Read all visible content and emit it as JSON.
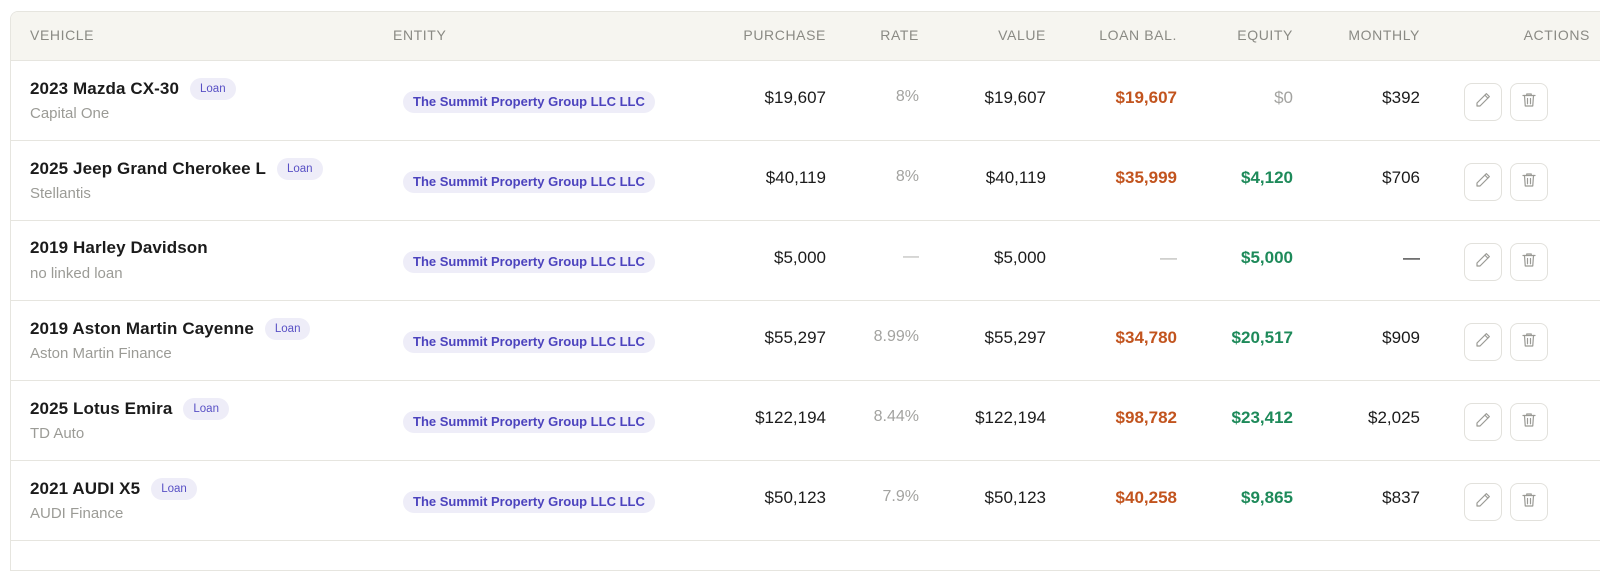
{
  "table": {
    "headers": {
      "vehicle": "VEHICLE",
      "entity": "ENTITY",
      "purchase": "PURCHASE",
      "rate": "RATE",
      "value": "VALUE",
      "loan_bal": "LOAN BAL.",
      "equity": "EQUITY",
      "monthly": "MONTHLY",
      "actions": "ACTIONS"
    },
    "rows": [
      {
        "name": "2023 Mazda CX-30",
        "badge": "Loan",
        "sub": "Capital One",
        "entity": "The Summit Property Group LLC LLC",
        "purchase": "$19,607",
        "rate": "8%",
        "value": "$19,607",
        "loan_bal": "$19,607",
        "equity": "$0",
        "monthly": "$392"
      },
      {
        "name": "2025 Jeep Grand Cherokee L",
        "badge": "Loan",
        "sub": "Stellantis",
        "entity": "The Summit Property Group LLC LLC",
        "purchase": "$40,119",
        "rate": "8%",
        "value": "$40,119",
        "loan_bal": "$35,999",
        "equity": "$4,120",
        "monthly": "$706"
      },
      {
        "name": "2019 Harley Davidson",
        "badge": "",
        "sub": "no linked loan",
        "entity": "The Summit Property Group LLC LLC",
        "purchase": "$5,000",
        "rate": "—",
        "value": "$5,000",
        "loan_bal": "—",
        "equity": "$5,000",
        "monthly": "—"
      },
      {
        "name": "2019 Aston Martin Cayenne",
        "badge": "Loan",
        "sub": "Aston Martin Finance",
        "entity": "The Summit Property Group LLC LLC",
        "purchase": "$55,297",
        "rate": "8.99%",
        "value": "$55,297",
        "loan_bal": "$34,780",
        "equity": "$20,517",
        "monthly": "$909"
      },
      {
        "name": "2025 Lotus Emira",
        "badge": "Loan",
        "sub": "TD Auto",
        "entity": "The Summit Property Group LLC LLC",
        "purchase": "$122,194",
        "rate": "8.44%",
        "value": "$122,194",
        "loan_bal": "$98,782",
        "equity": "$23,412",
        "monthly": "$2,025"
      },
      {
        "name": "2021 AUDI X5",
        "badge": "Loan",
        "sub": "AUDI Finance",
        "entity": "The Summit Property Group LLC LLC",
        "purchase": "$50,123",
        "rate": "7.9%",
        "value": "$50,123",
        "loan_bal": "$40,258",
        "equity": "$9,865",
        "monthly": "$837"
      }
    ]
  },
  "colors": {
    "loan_balance": "#c2541e",
    "equity": "#1e8a5a",
    "badge_bg": "#eeedf8",
    "badge_text": "#4c43be",
    "header_bg": "#f6f5f0"
  },
  "icons": {
    "edit": "pencil-icon",
    "delete": "trash-icon"
  }
}
